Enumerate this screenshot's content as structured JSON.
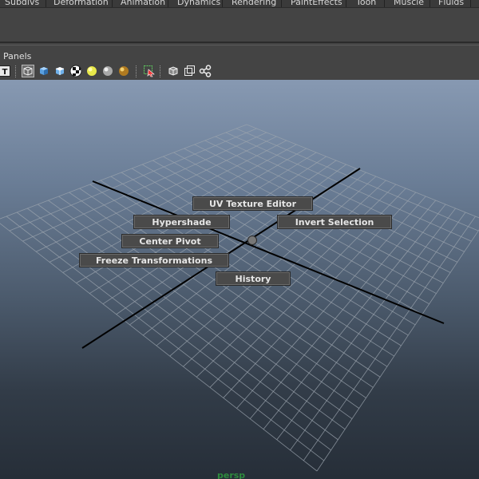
{
  "menubar": {
    "items": [
      "Subdivs",
      "Deformation",
      "Animation",
      "Dynamics",
      "Rendering",
      "PaintEffects",
      "Toon",
      "Muscle",
      "Fluids"
    ]
  },
  "panel": {
    "label": "Panels"
  },
  "toolbar": {
    "icons": [
      "text-icon",
      "wireframe-cube-icon",
      "shaded-cube-icon",
      "smooth-shaded-cube-icon",
      "checker-texture-icon",
      "default-light-icon",
      "all-lights-icon",
      "use-lights-icon",
      "isolate-select-icon",
      "xray-cube-icon",
      "xray-joints-icon",
      "connection-graph-icon"
    ]
  },
  "viewport": {
    "camera": "persp",
    "marking_menu": {
      "uv_texture_editor": "UV Texture Editor",
      "hypershade": "Hypershade",
      "invert_selection": "Invert Selection",
      "center_pivot": "Center Pivot",
      "freeze_transformations": "Freeze Transformations",
      "history": "History"
    }
  },
  "colors": {
    "camera_label": "#2e8b3e",
    "grid_line": "#9aa3ad",
    "axis_line": "#000000"
  }
}
